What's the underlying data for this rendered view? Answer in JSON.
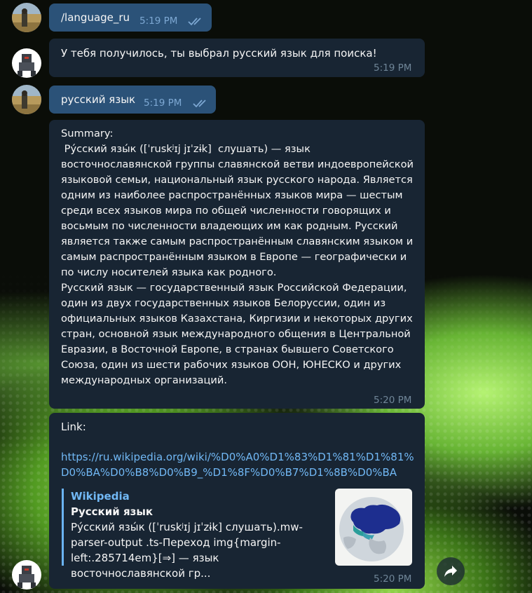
{
  "messages": [
    {
      "text": "/language_ru",
      "time": "5:19 PM"
    },
    {
      "text": "У тебя получилось, ты выбрал русский язык для поиска!",
      "time": "5:19 PM"
    },
    {
      "text": "русский язык",
      "time": "5:19 PM"
    },
    {
      "text": "Summary:\n Ру́сский язы́к ([ˈruskʲɪj jɪˈzɨk]  слушать) — язык восточнославянской группы славянской ветви индоевропейской языковой семьи, национальный язык русского народа. Является одним из наиболее распространённых языков мира — шестым среди всех языков мира по общей численности говорящих и восьмым по численности владеющих им как родным. Русский является также самым распространённым славянским языком и самым распространённым языком в Европе — географически и по числу носителей языка как родного.\nРусский язык — государственный язык Российской Федерации, один из двух государственных языков Белоруссии, один из официальных языков Казахстана, Киргизии и некоторых других стран, основной язык международного общения в Центральной Евразии, в Восточной Европе, в странах бывшего Советского Союза, один из шести рабочих языков ООН, ЮНЕСКО и других международных организаций.",
      "time": "5:20 PM"
    },
    {
      "label": "Link:",
      "url": "https://ru.wikipedia.org/wiki/%D0%A0%D1%83%D1%81%D1%81%D0%BA%D0%B8%D0%B9_%D1%8F%D0%B7%D1%8B%D0%BA",
      "time": "5:20 PM",
      "preview": {
        "site": "Wikipedia",
        "title": "Русский язык",
        "description": "Ру́сский язы́к ([ˈruskʲɪj jɪˈzɨk]  слушать).mw-parser-output .ts-Переход img{margin-left:.285714em}[⇒] — язык восточнославянской гр..."
      }
    }
  ],
  "icons": {
    "read_status": "double-check-icon",
    "forward": "share-arrow-icon"
  },
  "colors": {
    "incoming_bubble": "#182533",
    "outgoing_bubble": "#2b5278",
    "link": "#71b8f5",
    "time": "#6f8597"
  }
}
